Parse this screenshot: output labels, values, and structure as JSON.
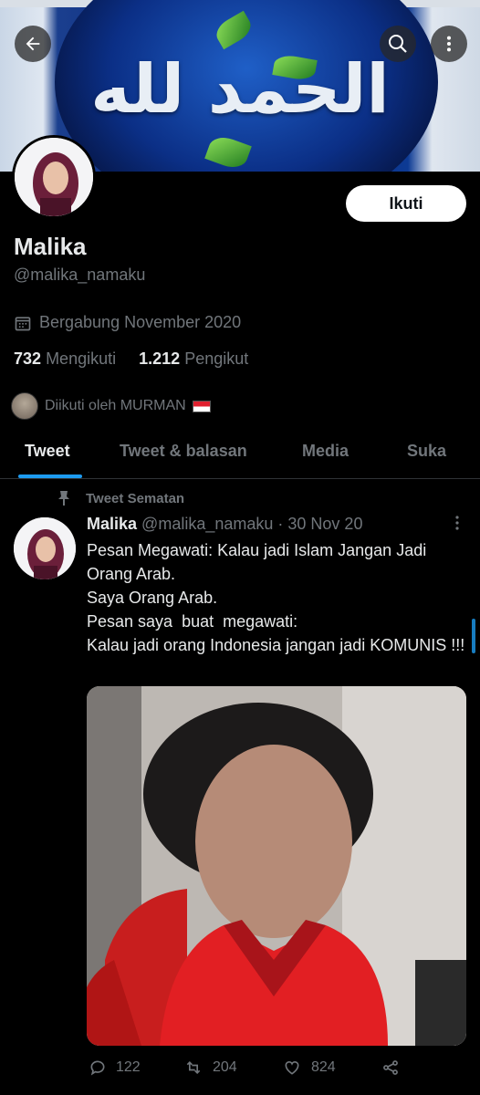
{
  "header": {
    "banner_text": "الحمد لله",
    "back_icon": "arrow-left-icon",
    "search_icon": "search-icon",
    "more_icon": "more-vertical-icon"
  },
  "profile": {
    "name": "Malika",
    "handle": "@malika_namaku",
    "follow_label": "Ikuti",
    "joined": "Bergabung November 2020",
    "following_count": "732",
    "following_label": "Mengikuti",
    "followers_count": "1.212",
    "followers_label": "Pengikut",
    "followed_by": "Diikuti oleh MURMAN"
  },
  "tabs": [
    {
      "label": "Tweet",
      "active": true
    },
    {
      "label": "Tweet & balasan",
      "active": false
    },
    {
      "label": "Media",
      "active": false
    },
    {
      "label": "Suka",
      "active": false
    }
  ],
  "tweet": {
    "pinned_label": "Tweet Sematan",
    "author": "Malika",
    "handle": "@malika_namaku",
    "date": "· 30 Nov 20",
    "text": "Pesan Megawati: Kalau jadi Islam Jangan Jadi Orang Arab.\nSaya Orang Arab.\nPesan saya  buat  megawati:\nKalau jadi orang Indonesia jangan jadi KOMUNIS !!!",
    "replies": "122",
    "retweets": "204",
    "likes": "824"
  },
  "colors": {
    "accent": "#1d9bf0",
    "background": "#000000",
    "muted": "#71767b"
  }
}
